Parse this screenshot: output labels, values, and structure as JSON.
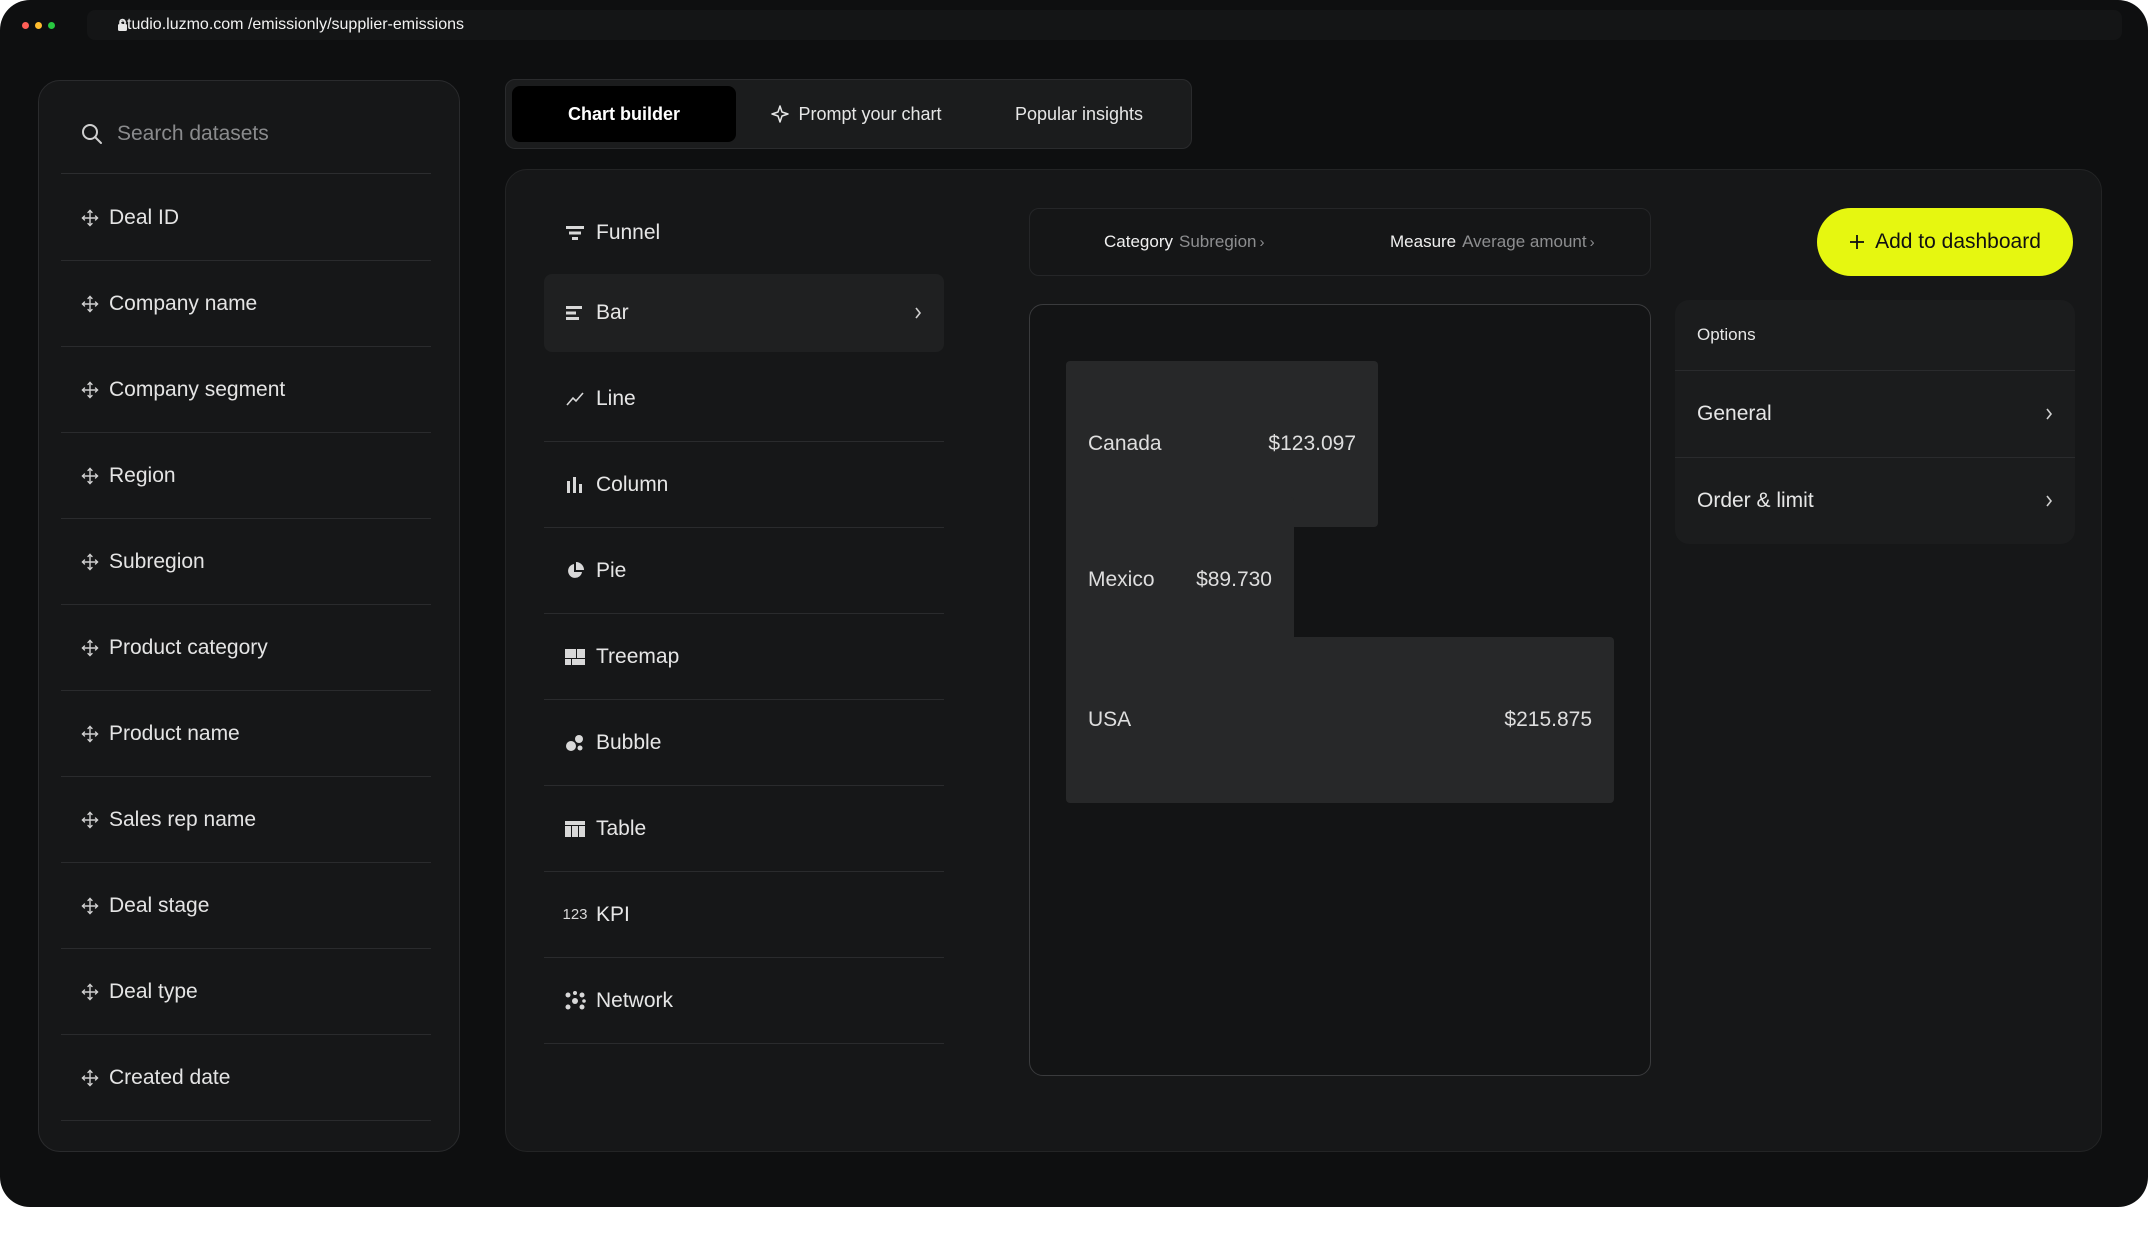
{
  "browser": {
    "url": "studio.luzmo.com /emissionly/supplier-emissions",
    "dot_colors": [
      "#ff5f57",
      "#febc2e",
      "#28c840"
    ]
  },
  "sidebar": {
    "search_placeholder": "Search datasets",
    "fields": [
      {
        "label": "Deal ID"
      },
      {
        "label": "Company name"
      },
      {
        "label": "Company segment"
      },
      {
        "label": "Region"
      },
      {
        "label": "Subregion"
      },
      {
        "label": "Product category"
      },
      {
        "label": "Product name"
      },
      {
        "label": "Sales rep name"
      },
      {
        "label": "Deal stage"
      },
      {
        "label": "Deal type"
      },
      {
        "label": "Created date"
      }
    ]
  },
  "tabs": [
    {
      "label": "Chart builder",
      "active": true
    },
    {
      "label": "Prompt your chart",
      "icon": "sparkle-icon"
    },
    {
      "label": "Popular insights"
    }
  ],
  "chart_types": [
    {
      "label": "Funnel",
      "icon": "funnel-icon"
    },
    {
      "label": "Bar",
      "icon": "bar-icon",
      "selected": true
    },
    {
      "label": "Line",
      "icon": "line-icon"
    },
    {
      "label": "Column",
      "icon": "column-icon"
    },
    {
      "label": "Pie",
      "icon": "pie-icon"
    },
    {
      "label": "Treemap",
      "icon": "treemap-icon"
    },
    {
      "label": "Bubble",
      "icon": "bubble-icon"
    },
    {
      "label": "Table",
      "icon": "table-icon"
    },
    {
      "label": "KPI",
      "icon": "kpi-icon",
      "icon_text": "123"
    },
    {
      "label": "Network",
      "icon": "network-icon"
    }
  ],
  "slots": {
    "category": {
      "key": "Category",
      "value": "Subregion"
    },
    "measure": {
      "key": "Measure",
      "value": "Average amount"
    }
  },
  "add_button": {
    "label": "Add to dashboard",
    "color": "#e6f710"
  },
  "chart_data": {
    "type": "bar",
    "orientation": "horizontal",
    "categories": [
      "Canada",
      "Mexico",
      "USA"
    ],
    "values": [
      123.097,
      89.73,
      215.875
    ],
    "value_labels": [
      "$123.097",
      "$89.730",
      "$215.875"
    ]
  },
  "options": {
    "header": "Options",
    "items": [
      {
        "label": "General"
      },
      {
        "label": "Order & limit"
      }
    ]
  }
}
